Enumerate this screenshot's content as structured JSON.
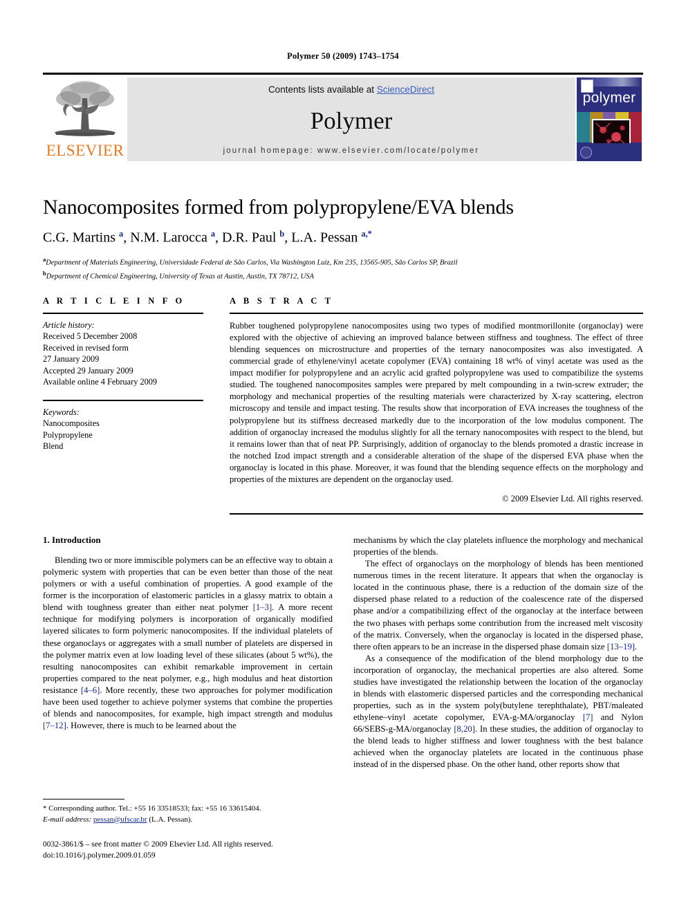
{
  "running_head": "Polymer 50 (2009) 1743–1754",
  "masthead": {
    "publisher_wordmark": "ELSEVIER",
    "contents_prefix": "Contents lists available at ",
    "contents_link": "ScienceDirect",
    "journal_name": "Polymer",
    "homepage": "journal homepage: www.elsevier.com/locate/polymer",
    "cover_title": "polymer",
    "accent_orange": "#E87722",
    "link_blue": "#3B5FC0",
    "cover_blue": "#2c2f7d"
  },
  "article": {
    "title": "Nanocomposites formed from polypropylene/EVA blends",
    "authors_html": "C.G. Martins <sup>a</sup>, N.M. Larocca <sup>a</sup>, D.R. Paul <sup>b</sup>, L.A. Pessan <sup>a,*</sup>",
    "affiliation_a": "Department of Materials Engineering, Universidade Federal de São Carlos, Via Washington Luiz, Km 235, 13565-905, São Carlos SP, Brazil",
    "affiliation_b": "Department of Chemical Engineering, University of Texas at Austin, Austin, TX 78712, USA"
  },
  "article_info": {
    "heading": "A R T I C L E    I N F O",
    "history_label": "Article history:",
    "history_lines": [
      "Received 5 December 2008",
      "Received in revised form",
      "27 January 2009",
      "Accepted 29 January 2009",
      "Available online 4 February 2009"
    ],
    "keywords_label": "Keywords:",
    "keywords": [
      "Nanocomposites",
      "Polypropylene",
      "Blend"
    ]
  },
  "abstract": {
    "heading": "A B S T R A C T",
    "text": "Rubber toughened polypropylene nanocomposites using two types of modified montmorillonite (organoclay) were explored with the objective of achieving an improved balance between stiffness and toughness. The effect of three blending sequences on microstructure and properties of the ternary nanocomposites was also investigated. A commercial grade of ethylene/vinyl acetate copolymer (EVA) containing 18 wt% of vinyl acetate was used as the impact modifier for polypropylene and an acrylic acid grafted polypropylene was used to compatibilize the systems studied. The toughened nanocomposites samples were prepared by melt compounding in a twin-screw extruder; the morphology and mechanical properties of the resulting materials were characterized by X-ray scattering, electron microscopy and tensile and impact testing. The results show that incorporation of EVA increases the toughness of the polypropylene but its stiffness decreased markedly due to the incorporation of the low modulus component. The addition of organoclay increased the modulus slightly for all the ternary nanocomposites with respect to the blend, but it remains lower than that of neat PP. Surprisingly, addition of organoclay to the blends promoted a drastic increase in the notched Izod impact strength and a considerable alteration of the shape of the dispersed EVA phase when the organoclay is located in this phase. Moreover, it was found that the blending sequence effects on the morphology and properties of the mixtures are dependent on the organoclay used.",
    "copyright": "© 2009 Elsevier Ltd. All rights reserved."
  },
  "introduction": {
    "section_title": "1.  Introduction",
    "left_paragraph_1_html": "Blending two or more immiscible polymers can be an effective way to obtain a polymeric system with properties that can be even better than those of the neat polymers or with a useful combination of properties. A good example of the former is the incorporation of elastomeric particles in a glassy matrix to obtain a blend with toughness greater than either neat polymer <span class=\"ref\">[1–3]</span>. A more recent technique for modifying polymers is incorporation of organically modified layered silicates to form polymeric nanocomposites. If the individual platelets of these organoclays or aggregates with a small number of platelets are dispersed in the polymer matrix even at low loading level of these silicates (about 5 wt%), the resulting nanocomposites can exhibit remarkable improvement in certain properties compared to the neat polymer, e.g., high modulus and heat distortion resistance <span class=\"ref\">[4–6]</span>. More recently, these two approaches for polymer modification have been used together to achieve polymer systems that combine the properties of blends and nanocomposites, for example, high impact strength and modulus <span class=\"ref\">[7–12]</span>. However, there is much to be learned about the",
    "right_paragraph_1_html": "mechanisms by which the clay platelets influence the morphology and mechanical properties of the blends.",
    "right_paragraph_2_html": "The effect of organoclays on the morphology of blends has been mentioned numerous times in the recent literature. It appears that when the organoclay is located in the continuous phase, there is a reduction of the domain size of the dispersed phase related to a reduction of the coalescence rate of the dispersed phase and/or a compatibilizing effect of the organoclay at the interface between the two phases with perhaps some contribution from the increased melt viscosity of the matrix. Conversely, when the organoclay is located in the dispersed phase, there often appears to be an increase in the dispersed phase domain size <span class=\"ref\">[13–19]</span>.",
    "right_paragraph_3_html": "As a consequence of the modification of the blend morphology due to the incorporation of organoclay, the mechanical properties are also altered. Some studies have investigated the relationship between the location of the organoclay in blends with elastomeric dispersed particles and the corresponding mechanical properties, such as in the system poly(butylene terephthalate), PBT/maleated ethylene–vinyl acetate copolymer, EVA-g-MA/organoclay <span class=\"ref\">[7]</span> and Nylon 66/SEBS-g-MA/organoclay <span class=\"ref\">[8,20]</span>. In these studies, the addition of organoclay to the blend leads to higher stiffness and lower toughness with the best balance achieved when the organoclay platelets are located in the continuous phase instead of in the dispersed phase. On the other hand, other reports show that"
  },
  "footnotes": {
    "corresponding_html": "* Corresponding author. Tel.: +55 16 33518533; fax: +55 16 33615404.",
    "email_label": "E-mail address:",
    "email": "pessan@ufscar.br",
    "email_suffix": " (L.A. Pessan)."
  },
  "imprint": {
    "line1": "0032-3861/$ – see front matter © 2009 Elsevier Ltd. All rights reserved.",
    "line2": "doi:10.1016/j.polymer.2009.01.059"
  }
}
